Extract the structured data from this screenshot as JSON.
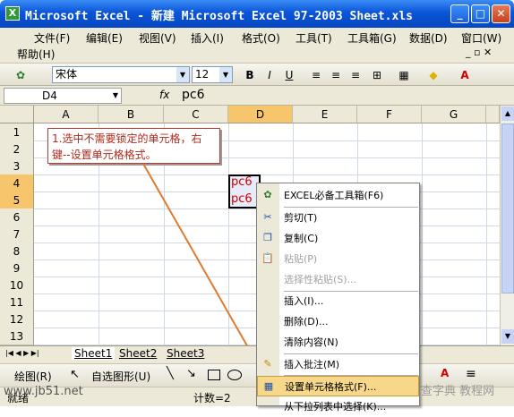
{
  "window": {
    "title": "Microsoft Excel - 新建 Microsoft Excel 97-2003 Sheet.xls",
    "app_icon": "X"
  },
  "menu": [
    {
      "label": "文件(F)"
    },
    {
      "label": "编辑(E)"
    },
    {
      "label": "视图(V)"
    },
    {
      "label": "插入(I)"
    },
    {
      "label": "格式(O)"
    },
    {
      "label": "工具(T)"
    },
    {
      "label": "工具箱(G)"
    },
    {
      "label": "数据(D)"
    },
    {
      "label": "窗口(W)"
    },
    {
      "label": "帮助(H)"
    }
  ],
  "toolbar": {
    "font": "宋体",
    "size": "12",
    "bold": "B",
    "italic": "I",
    "underline": "U"
  },
  "formula": {
    "name_box": "D4",
    "fx": "fx",
    "value": "pc6"
  },
  "columns": [
    "A",
    "B",
    "C",
    "D",
    "E",
    "F",
    "G"
  ],
  "rows": [
    "1",
    "2",
    "3",
    "4",
    "5",
    "6",
    "7",
    "8",
    "9",
    "10",
    "11",
    "12",
    "13"
  ],
  "cells": {
    "d4": "pc6",
    "d5": "pc6"
  },
  "callout": {
    "text": "1.选中不需要锁定的单元格，右键--设置单元格格式。"
  },
  "sheets": [
    "Sheet1",
    "Sheet2",
    "Sheet3"
  ],
  "drawbar": {
    "draw": "绘图(R)",
    "autoshape": "自选图形(U)"
  },
  "status": {
    "left": "就绪",
    "count": "计数=2"
  },
  "context_menu": [
    {
      "label": "EXCEL必备工具箱(F6)",
      "icon": "excel-toolbox-icon",
      "glyph": "✿",
      "disabled": false
    },
    {
      "label": "剪切(T)",
      "icon": "scissors-icon",
      "glyph": "✂",
      "disabled": false
    },
    {
      "label": "复制(C)",
      "icon": "copy-icon",
      "glyph": "❐",
      "disabled": false
    },
    {
      "label": "粘贴(P)",
      "icon": "paste-icon",
      "glyph": "📋",
      "disabled": true
    },
    {
      "label": "选择性粘贴(S)...",
      "icon": "",
      "glyph": "",
      "disabled": true
    },
    {
      "label": "插入(I)...",
      "icon": "",
      "glyph": "",
      "disabled": false
    },
    {
      "label": "删除(D)...",
      "icon": "",
      "glyph": "",
      "disabled": false
    },
    {
      "label": "清除内容(N)",
      "icon": "",
      "glyph": "",
      "disabled": false
    },
    {
      "label": "插入批注(M)",
      "icon": "comment-icon",
      "glyph": "✎",
      "disabled": false
    },
    {
      "label": "设置单元格格式(F)...",
      "icon": "format-cells-icon",
      "glyph": "▦",
      "disabled": false,
      "highlighted": true
    },
    {
      "label": "从下拉列表中选择(K)...",
      "icon": "",
      "glyph": "",
      "disabled": false
    }
  ],
  "watermarks": {
    "left": "www.jb51.net",
    "right": "查字典 教程网"
  },
  "colors": {
    "title_bar": "#0a55d8",
    "selection_header": "#f7c56b",
    "callout_text": "#b0281a",
    "cell_text": "#cc0000",
    "highlight": "#f7d88b"
  }
}
